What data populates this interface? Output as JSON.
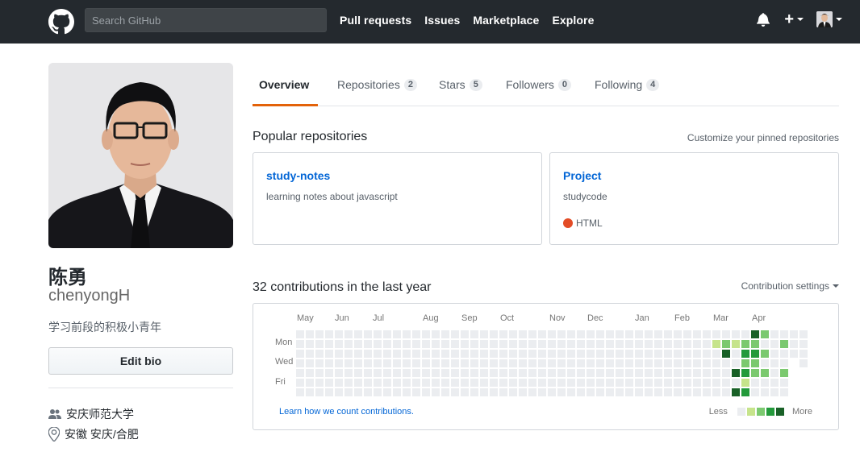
{
  "header": {
    "search_placeholder": "Search GitHub",
    "nav": [
      "Pull requests",
      "Issues",
      "Marketplace",
      "Explore"
    ],
    "plus_label": "+"
  },
  "profile": {
    "fullname": "陈勇",
    "username": "chenyongH",
    "bio": "学习前段的积极小青年",
    "edit_bio_label": "Edit bio",
    "organization": "安庆师范大学",
    "location": "安徽 安庆/合肥"
  },
  "tabs": [
    {
      "label": "Overview",
      "count": null
    },
    {
      "label": "Repositories",
      "count": "2"
    },
    {
      "label": "Stars",
      "count": "5"
    },
    {
      "label": "Followers",
      "count": "0"
    },
    {
      "label": "Following",
      "count": "4"
    }
  ],
  "popular": {
    "title": "Popular repositories",
    "customize": "Customize your pinned repositories",
    "repos": [
      {
        "name": "study-notes",
        "description": "learning notes about javascript",
        "language": ""
      },
      {
        "name": "Project",
        "description": "studycode",
        "language": "HTML"
      }
    ]
  },
  "contributions": {
    "title": "32 contributions in the last year",
    "settings": "Contribution settings",
    "months": [
      "May",
      "Jun",
      "Jul",
      "Aug",
      "Sep",
      "Oct",
      "Nov",
      "Dec",
      "Jan",
      "Feb",
      "Mar",
      "Apr"
    ],
    "days": [
      "Mon",
      "Wed",
      "Fri"
    ],
    "learn": "Learn how we count contributions.",
    "legend_less": "Less",
    "legend_more": "More",
    "colors": [
      "#ebedf0",
      "#c6e48b",
      "#7bc96f",
      "#239a3b",
      "#196127"
    ]
  }
}
